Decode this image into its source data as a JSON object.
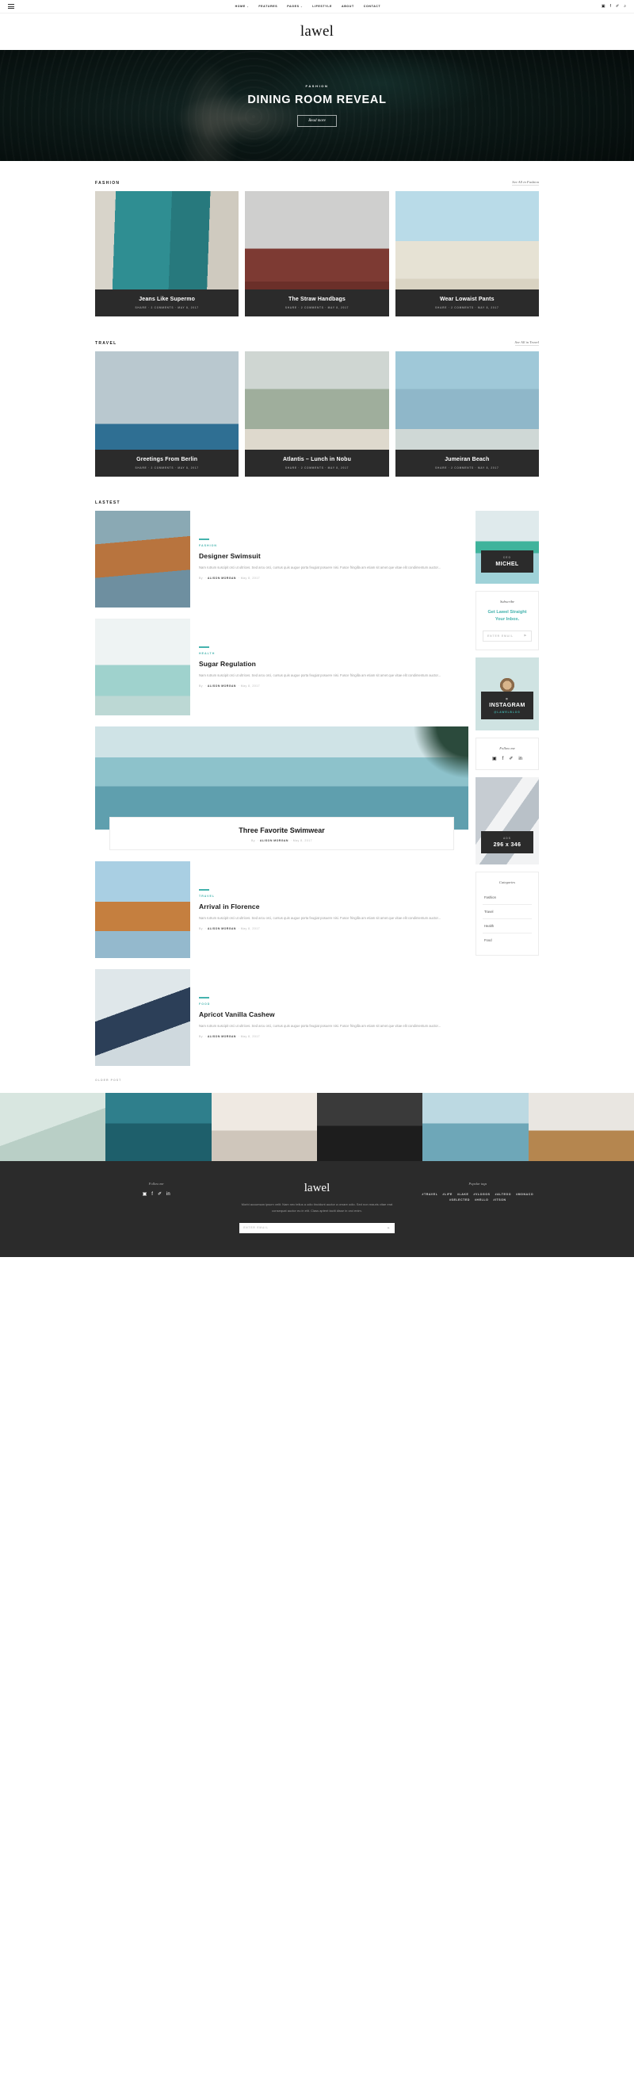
{
  "topbar": {
    "menu_icon": "hamburger-icon",
    "nav": [
      {
        "label": "HOME",
        "caret": "⌄"
      },
      {
        "label": "FEATURES",
        "caret": ""
      },
      {
        "label": "PAGES",
        "caret": "⌄"
      },
      {
        "label": "LIFESTYLE",
        "caret": ""
      },
      {
        "label": "ABOUT",
        "caret": ""
      },
      {
        "label": "CONTACT",
        "caret": ""
      }
    ],
    "social": [
      {
        "name": "instagram-icon",
        "glyph": "▣"
      },
      {
        "name": "facebook-icon",
        "glyph": "f"
      },
      {
        "name": "twitter-icon",
        "glyph": "✐"
      },
      {
        "name": "search-icon",
        "glyph": "⌕"
      }
    ]
  },
  "brand": {
    "logo": "lawel"
  },
  "hero": {
    "category": "FASHION",
    "title": "DINING ROOM REVEAL",
    "button": "Read more"
  },
  "sections": [
    {
      "title": "FASHION",
      "link": "See All in Fashion",
      "cards": [
        {
          "title": "Jeans Like Supermo",
          "meta": "SHARE  ·  2 COMMENTS  ·  MAY 8, 2017",
          "img": "img-door"
        },
        {
          "title": "The Straw Handbags",
          "meta": "SHARE  ·  2 COMMENTS  ·  MAY 8, 2017",
          "img": "img-laundry"
        },
        {
          "title": "Wear Lowaist Pants",
          "meta": "SHARE  ·  2 COMMENTS  ·  MAY 8, 2017",
          "img": "img-beach"
        }
      ]
    },
    {
      "title": "TRAVEL",
      "link": "See All in Travel",
      "cards": [
        {
          "title": "Greetings From Berlin",
          "meta": "SHARE  ·  2 COMMENTS  ·  MAY 8, 2017",
          "img": "img-berlin"
        },
        {
          "title": "Atlantis – Lunch in Nobu",
          "meta": "SHARE  ·  2 COMMENTS  ·  MAY 8, 2017",
          "img": "img-atlantis"
        },
        {
          "title": "Jumeiran Beach",
          "meta": "SHARE  ·  2 COMMENTS  ·  MAY 8, 2017",
          "img": "img-jumeiran"
        }
      ]
    }
  ],
  "latest": {
    "title": "LASTEST",
    "older_link": "OLDER POST",
    "excerpt": "Nam rutrum suscipit orci ut ultrices. Sed arcu orci, cursus quis augue porta feugiat posuere nisi. Fusce fringilla am etiam sit amet que vitae elit condimentum auctor...",
    "posts": [
      {
        "category": "FASHION",
        "title": "Designer Swimsuit",
        "by_prefix": "By",
        "author": "ALISON MORGAN",
        "date": "May 8, 2017",
        "img": "th-hair"
      },
      {
        "category": "HEALTH",
        "title": "Sugar Regulation",
        "by_prefix": "By",
        "author": "ALISON MORGAN",
        "date": "May 8, 2017",
        "img": "th-lifeguard"
      },
      {
        "category": "TRAVEL",
        "title": "Arrival in Florence",
        "by_prefix": "By",
        "author": "ALISON MORGAN",
        "date": "May 8, 2017",
        "img": "th-pier"
      },
      {
        "category": "FOOD",
        "title": "Apricot Vanilla Cashew",
        "by_prefix": "By",
        "author": "ALISON MORGAN",
        "date": "May 8, 2017",
        "img": "th-abstract"
      }
    ],
    "feature": {
      "title": "Three Favorite Swimwear",
      "by_prefix": "By",
      "author": "ALISON MORGAN",
      "date": "May 8, 2017"
    }
  },
  "sidebar": {
    "author": {
      "kicker": "CEO",
      "name": "MICHEL"
    },
    "subscribe": {
      "head": "Subscribe",
      "lead": "Get Lawel Straight Your Inbox.",
      "placeholder": "ENTER EMAIL",
      "submit": "▶"
    },
    "instagram": {
      "icon": "instagram-icon",
      "name": "INSTAGRAM",
      "handle": "@LAWELBLOG"
    },
    "follow": {
      "head": "Follow me",
      "social": [
        {
          "name": "instagram-icon",
          "glyph": "▣"
        },
        {
          "name": "facebook-icon",
          "glyph": "f"
        },
        {
          "name": "twitter-icon",
          "glyph": "✐"
        },
        {
          "name": "linkedin-icon",
          "glyph": "in"
        }
      ]
    },
    "ads": {
      "kicker": "ADS",
      "size": "296 x 346"
    },
    "categories": {
      "head": "Categories",
      "items": [
        "Fashion",
        "Travel",
        "Health",
        "Food"
      ]
    }
  },
  "instagram_strip": [
    "ig1",
    "ig2",
    "ig3",
    "ig4",
    "ig5",
    "ig6"
  ],
  "footer": {
    "follow_head": "Follow me",
    "social": [
      {
        "name": "instagram-icon",
        "glyph": "▣"
      },
      {
        "name": "facebook-icon",
        "glyph": "f"
      },
      {
        "name": "twitter-icon",
        "glyph": "✐"
      },
      {
        "name": "linkedin-icon",
        "glyph": "in"
      }
    ],
    "logo": "lawel",
    "about": "Morbi accumsan ipsum velit. Nam nec tellus a odio tincidunt auctor a ornare odio. Sed non mauris vitae erat consequat auctor eu in elit. Class aptent taciti disse in orci enim.",
    "email_placeholder": "ENTER EMAIL",
    "email_submit": "▶",
    "tags_head": "Popular tags",
    "tags": [
      "#TRAVEL",
      "#LIFE",
      "#LAKE",
      "#VLOGOS",
      "#ALTEGO",
      "#MONACO",
      "#SELECTED",
      "#HELLO",
      "#ITSON"
    ]
  }
}
